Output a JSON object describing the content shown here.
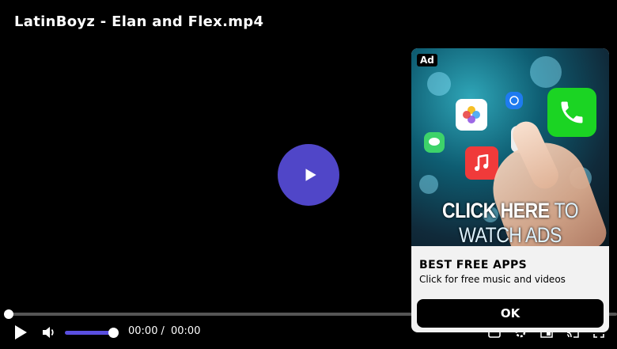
{
  "video": {
    "title": "LatinBoyz - Elan and Flex.mp4",
    "progress": 0,
    "volume": 1.0
  },
  "controls": {
    "current_time": "00:00",
    "separator": "/",
    "duration": "00:00",
    "icons": [
      "play-icon",
      "volume-icon",
      "subtitles-icon",
      "settings-icon",
      "pip-icon",
      "cast-icon",
      "fullscreen-icon"
    ]
  },
  "ad": {
    "badge": "Ad",
    "image_caption_main": "CLICK HERE",
    "image_caption_rest": "TO WATCH ADS",
    "headline": "BEST FREE APPS",
    "description": "Click for free music and videos",
    "cta": "OK"
  },
  "colors": {
    "accent": "#5046c8",
    "volume_bar": "#5a4fe0"
  }
}
